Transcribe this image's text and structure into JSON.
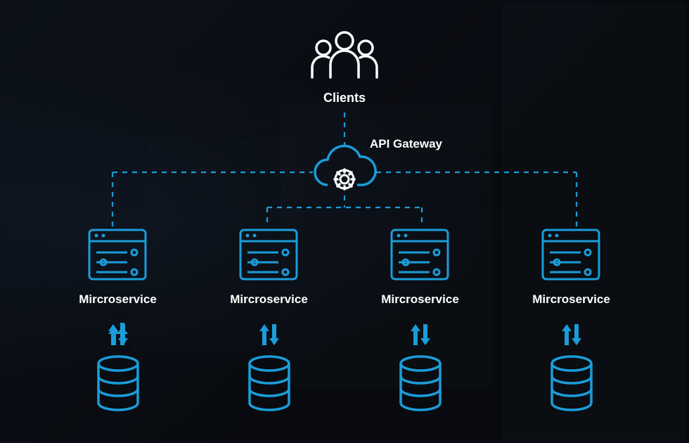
{
  "colors": {
    "accent": "#1a9dd9",
    "line": "#1a9dd9",
    "text": "#ffffff"
  },
  "clients": {
    "label": "Clients"
  },
  "gateway": {
    "label": "API Gateway"
  },
  "services": [
    {
      "label": "Mircroservice"
    },
    {
      "label": "Mircroservice"
    },
    {
      "label": "Mircroservice"
    },
    {
      "label": "Mircroservice"
    }
  ]
}
